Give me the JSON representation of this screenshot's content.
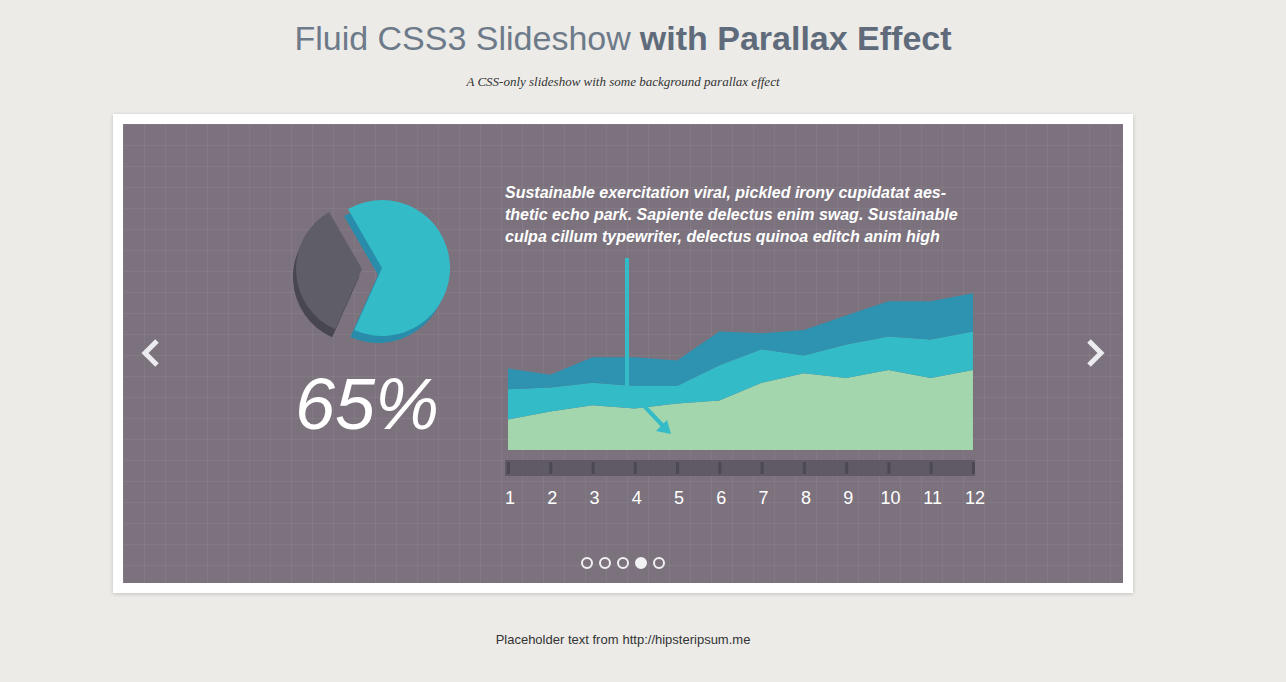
{
  "header": {
    "title_light": "Fluid CSS3 Slideshow",
    "title_bold": "with Parallax Effect",
    "subtitle": "A CSS-only slideshow with some background parallax effect"
  },
  "slide": {
    "pie": {
      "share": 0.65,
      "label": "65%"
    },
    "text_lines": [
      "Sustainable exercitation viral, pickled irony cupidatat aes-",
      "thetic echo park. Sapiente delectus enim swag. Sustainable",
      "culpa cillum typewriter, delectus quinoa editch anim high"
    ],
    "chart": {
      "x_labels": [
        "1",
        "2",
        "3",
        "4",
        "5",
        "6",
        "7",
        "8",
        "9",
        "10",
        "11",
        "12"
      ],
      "series": [
        {
          "values": [
            19,
            24,
            28,
            26,
            29,
            31,
            42,
            48,
            45,
            50,
            45,
            50
          ],
          "color": "#a3d6ad"
        },
        {
          "values": [
            19,
            15,
            14,
            14,
            11,
            22,
            21,
            11,
            21,
            21,
            24,
            24
          ],
          "color": "#33bbc7"
        },
        {
          "values": [
            13,
            8,
            16,
            18,
            16,
            21,
            10,
            16,
            18,
            22,
            24,
            24
          ],
          "color": "#2d93b1"
        }
      ]
    }
  },
  "pager": [
    {
      "selected": false
    },
    {
      "selected": false
    },
    {
      "selected": false
    },
    {
      "selected": true
    },
    {
      "selected": false
    }
  ],
  "footer": {
    "text": "Placeholder text from",
    "link": "http://hipsteripsum.me"
  }
}
